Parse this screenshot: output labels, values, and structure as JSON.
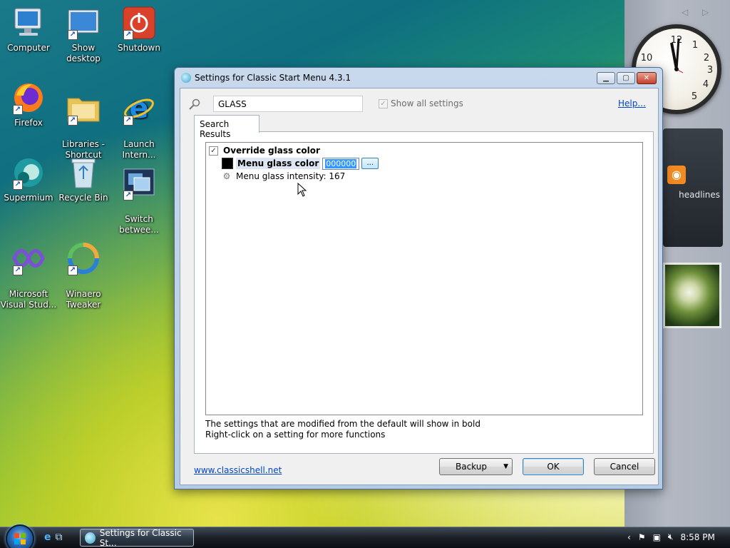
{
  "desktop": {
    "icons": [
      {
        "label": "Computer"
      },
      {
        "label": "Show desktop"
      },
      {
        "label": "Shutdown"
      },
      {
        "label": "Firefox"
      },
      {
        "label": "Libraries -\nShortcut"
      },
      {
        "label": "Launch\nIntern..."
      },
      {
        "label": "Supermium"
      },
      {
        "label": "Recycle Bin"
      },
      {
        "label": "Switch\nbetwee..."
      },
      {
        "label": "Microsoft\nVisual Stud..."
      },
      {
        "label": "Winaero\nTweaker"
      }
    ]
  },
  "sidebar": {
    "headlines_label": "headlines"
  },
  "dialog": {
    "title": "Settings for Classic Start Menu 4.3.1",
    "search_value": "GLASS",
    "show_all_label": "Show all settings",
    "help_label": "Help...",
    "tab_label": "Search Results",
    "settings": {
      "override_label": "Override glass color",
      "menu_color_label": "Menu glass color",
      "menu_color_value": "000000",
      "browse_label": "...",
      "intensity_label": "Menu glass intensity: 167"
    },
    "note_line1": "The settings that are modified from the default will show in bold",
    "note_line2": "Right-click on a setting for more functions",
    "site_link": "www.classicshell.net",
    "backup_label": "Backup",
    "ok_label": "OK",
    "cancel_label": "Cancel"
  },
  "taskbar": {
    "task_label": "Settings for Classic St...",
    "clock": "8:58 PM"
  },
  "colors": {
    "accent": "#3399ff",
    "link": "#0046c9"
  }
}
